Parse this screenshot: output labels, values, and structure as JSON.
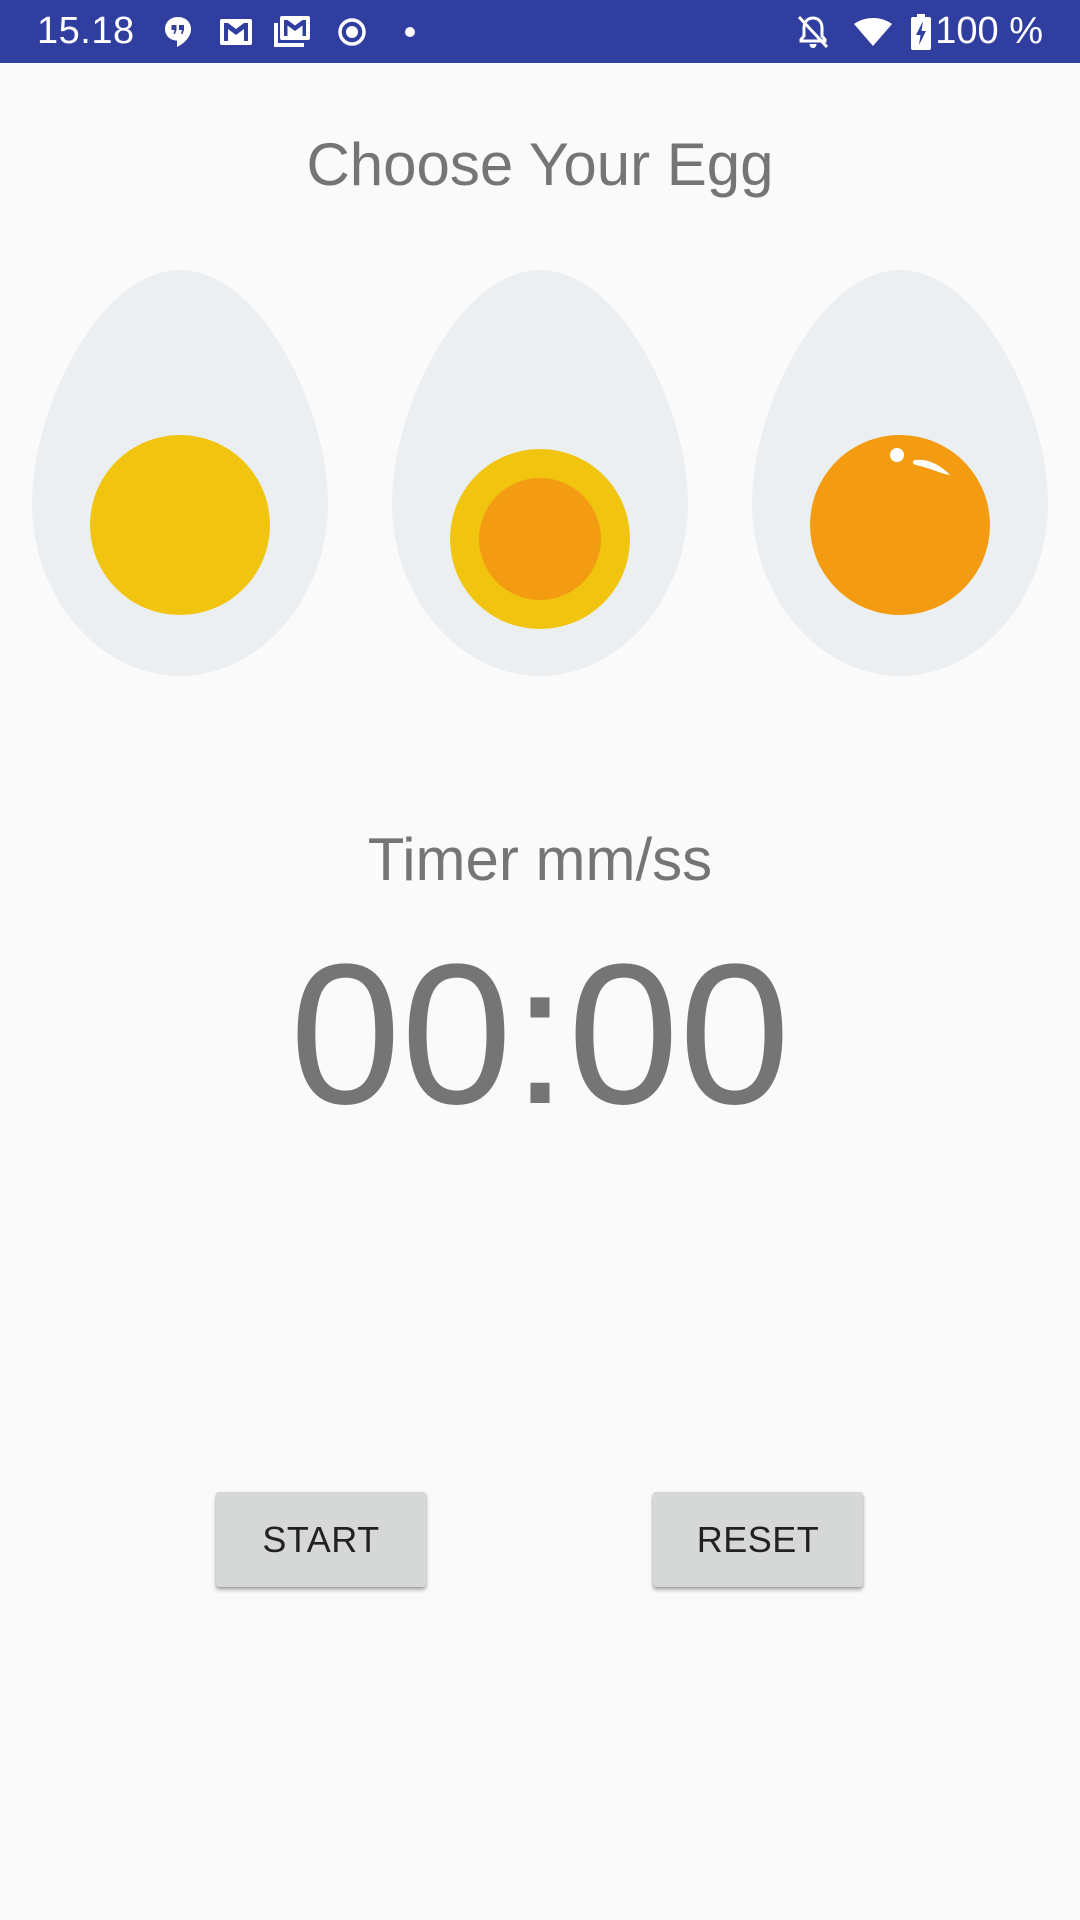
{
  "status_bar": {
    "time": "15.18",
    "battery": "100 %",
    "background": "#303f9f",
    "left_icons": [
      "hangouts-icon",
      "gmail-icon",
      "gmail-multi-icon",
      "record-icon",
      "dot-icon"
    ],
    "right_icons": [
      "alarm-off-icon",
      "wifi-icon",
      "battery-charging-icon"
    ]
  },
  "header": {
    "title": "Choose Your Egg"
  },
  "eggs": [
    {
      "name": "soft",
      "icon": "soft-boiled-egg-icon",
      "white": "#eceff1",
      "yolk": "#f1c40f"
    },
    {
      "name": "medium",
      "icon": "medium-boiled-egg-icon",
      "white": "#eceff1",
      "yolk_outer": "#f1c40f",
      "yolk_inner": "#f39c12"
    },
    {
      "name": "hard",
      "icon": "hard-boiled-egg-icon",
      "white": "#eceff1",
      "yolk": "#f39c12"
    }
  ],
  "timer": {
    "label": "Timer mm/ss",
    "value": "00:00"
  },
  "buttons": {
    "start": "START",
    "reset": "RESET"
  }
}
